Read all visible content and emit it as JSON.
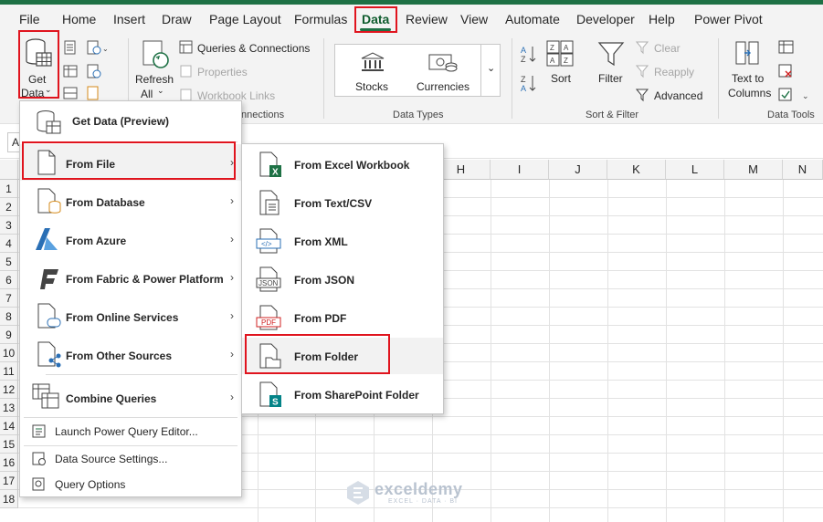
{
  "menu_tabs": [
    "File",
    "Home",
    "Insert",
    "Draw",
    "Page Layout",
    "Formulas",
    "Data",
    "Review",
    "View",
    "Automate",
    "Developer",
    "Help",
    "Power Pivot"
  ],
  "active_tab": "Data",
  "ribbon": {
    "get_data": [
      "Get",
      "Data"
    ],
    "refresh": [
      "Refresh",
      "All"
    ],
    "queries_connections": "Queries & Connections",
    "properties": "Properties",
    "workbook_links": "Workbook Links",
    "group_queries": "nnections",
    "stocks": "Stocks",
    "currencies": "Currencies",
    "group_data_types": "Data Types",
    "sort": "Sort",
    "filter": "Filter",
    "clear": "Clear",
    "reapply": "Reapply",
    "advanced": "Advanced",
    "group_sort_filter": "Sort & Filter",
    "text_to_columns": [
      "Text to",
      "Columns"
    ],
    "group_data_tools": "Data Tools"
  },
  "name_box": "A",
  "columns": [
    "H",
    "I",
    "J",
    "K",
    "L",
    "M",
    "N"
  ],
  "rows": [
    "1",
    "2",
    "3",
    "4",
    "5",
    "6",
    "7",
    "8",
    "9",
    "10",
    "11",
    "12",
    "13",
    "14",
    "15",
    "16",
    "17",
    "18"
  ],
  "get_data_menu": {
    "items": [
      {
        "label": "Get Data (Preview)",
        "submenu": false
      },
      {
        "label": "From File",
        "submenu": true
      },
      {
        "label": "From Database",
        "submenu": true
      },
      {
        "label": "From Azure",
        "submenu": true
      },
      {
        "label": "From Fabric & Power Platform",
        "submenu": true
      },
      {
        "label": "From Online Services",
        "submenu": true
      },
      {
        "label": "From Other Sources",
        "submenu": true
      },
      {
        "label": "Combine Queries",
        "submenu": true
      }
    ],
    "footer_items": [
      "Launch Power Query Editor...",
      "Data Source Settings...",
      "Query Options"
    ]
  },
  "from_file_menu": {
    "items": [
      {
        "label": "From Excel Workbook",
        "icon": "excel-file-icon"
      },
      {
        "label": "From Text/CSV",
        "icon": "text-file-icon"
      },
      {
        "label": "From XML",
        "icon": "xml-file-icon"
      },
      {
        "label": "From JSON",
        "icon": "json-file-icon"
      },
      {
        "label": "From PDF",
        "icon": "pdf-file-icon"
      },
      {
        "label": "From Folder",
        "icon": "folder-file-icon"
      },
      {
        "label": "From SharePoint Folder",
        "icon": "sharepoint-file-icon"
      }
    ],
    "icon_tags": {
      "xml": "</>",
      "json": "JSON",
      "pdf": "PDF",
      "excel": "X",
      "sharepoint": "S"
    }
  },
  "watermark": {
    "brand": "exceldemy",
    "tagline": "EXCEL · DATA · BI"
  },
  "colors": {
    "accent": "#1e7145",
    "highlight_box": "#e0141e",
    "excel_green": "#1e7145"
  }
}
